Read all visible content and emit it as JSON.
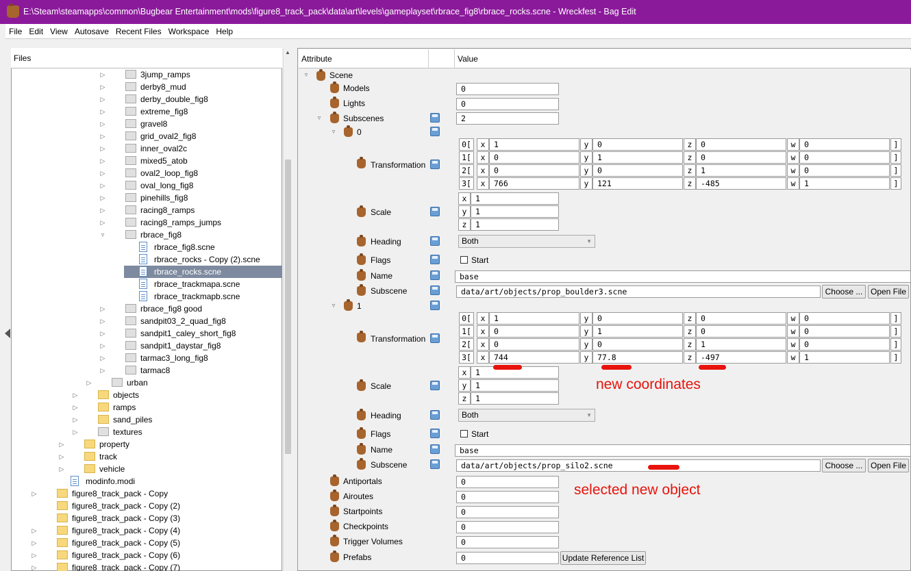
{
  "window": {
    "title": "E:\\Steam\\steamapps\\common\\Bugbear Entertainment\\mods\\figure8_track_pack\\data\\art\\levels\\gameplayset\\rbrace_fig8\\rbrace_rocks.scne - Wreckfest - Bag Edit",
    "title_color": "#8b1a9b"
  },
  "menu": [
    "File",
    "Edit",
    "View",
    "Autosave",
    "Recent Files",
    "Workspace",
    "Help"
  ],
  "files": {
    "header": "Files",
    "items": [
      {
        "label": "3jump_ramps",
        "type": "folder-gray",
        "indent": 3,
        "expander": "▷"
      },
      {
        "label": "derby8_mud",
        "type": "folder-gray",
        "indent": 3,
        "expander": "▷"
      },
      {
        "label": "derby_double_fig8",
        "type": "folder-gray",
        "indent": 3,
        "expander": "▷"
      },
      {
        "label": "extreme_fig8",
        "type": "folder-gray",
        "indent": 3,
        "expander": "▷"
      },
      {
        "label": "gravel8",
        "type": "folder-gray",
        "indent": 3,
        "expander": "▷"
      },
      {
        "label": "grid_oval2_fig8",
        "type": "folder-gray",
        "indent": 3,
        "expander": "▷"
      },
      {
        "label": "inner_oval2c",
        "type": "folder-gray",
        "indent": 3,
        "expander": "▷"
      },
      {
        "label": "mixed5_atob",
        "type": "folder-gray",
        "indent": 3,
        "expander": "▷"
      },
      {
        "label": "oval2_loop_fig8",
        "type": "folder-gray",
        "indent": 3,
        "expander": "▷"
      },
      {
        "label": "oval_long_fig8",
        "type": "folder-gray",
        "indent": 3,
        "expander": "▷"
      },
      {
        "label": "pinehills_fig8",
        "type": "folder-gray",
        "indent": 3,
        "expander": "▷"
      },
      {
        "label": "racing8_ramps",
        "type": "folder-gray",
        "indent": 3,
        "expander": "▷"
      },
      {
        "label": "racing8_ramps_jumps",
        "type": "folder-gray",
        "indent": 3,
        "expander": "▷"
      },
      {
        "label": "rbrace_fig8",
        "type": "folder-gray",
        "indent": 3,
        "expander": "▿"
      },
      {
        "label": "rbrace_fig8.scne",
        "type": "doc",
        "indent": 4,
        "expander": ""
      },
      {
        "label": "rbrace_rocks - Copy (2).scne",
        "type": "doc",
        "indent": 4,
        "expander": ""
      },
      {
        "label": "rbrace_rocks.scne",
        "type": "doc",
        "indent": 4,
        "expander": "",
        "selected": true
      },
      {
        "label": "rbrace_trackmapa.scne",
        "type": "doc",
        "indent": 4,
        "expander": ""
      },
      {
        "label": "rbrace_trackmapb.scne",
        "type": "doc",
        "indent": 4,
        "expander": ""
      },
      {
        "label": "rbrace_fig8 good",
        "type": "folder-gray",
        "indent": 3,
        "expander": "▷"
      },
      {
        "label": "sandpit03_2_quad_fig8",
        "type": "folder-gray",
        "indent": 3,
        "expander": "▷"
      },
      {
        "label": "sandpit1_caley_short_fig8",
        "type": "folder-gray",
        "indent": 3,
        "expander": "▷"
      },
      {
        "label": "sandpit1_daystar_fig8",
        "type": "folder-gray",
        "indent": 3,
        "expander": "▷"
      },
      {
        "label": "tarmac3_long_fig8",
        "type": "folder-gray",
        "indent": 3,
        "expander": "▷"
      },
      {
        "label": "tarmac8",
        "type": "folder-gray",
        "indent": 3,
        "expander": "▷"
      },
      {
        "label": "urban",
        "type": "folder-gray",
        "indent": 2,
        "expander": "▷"
      },
      {
        "label": "objects",
        "type": "folder-yellow",
        "indent": 1,
        "expander": "▷"
      },
      {
        "label": "ramps",
        "type": "folder-yellow",
        "indent": 1,
        "expander": "▷"
      },
      {
        "label": "sand_piles",
        "type": "folder-yellow",
        "indent": 1,
        "expander": "▷"
      },
      {
        "label": "textures",
        "type": "folder-gray",
        "indent": 1,
        "expander": "▷"
      },
      {
        "label": "property",
        "type": "folder-yellow",
        "indent": 0,
        "expander": "▷"
      },
      {
        "label": "track",
        "type": "folder-yellow",
        "indent": 0,
        "expander": "▷"
      },
      {
        "label": "vehicle",
        "type": "folder-yellow",
        "indent": 0,
        "expander": "▷"
      },
      {
        "label": "modinfo.modi",
        "type": "doc",
        "indent": -1,
        "expander": ""
      },
      {
        "label": "figure8_track_pack - Copy",
        "type": "folder-yellow",
        "indent": -2,
        "expander": "▷"
      },
      {
        "label": "figure8_track_pack - Copy (2)",
        "type": "folder-yellow",
        "indent": -2,
        "expander": ""
      },
      {
        "label": "figure8_track_pack - Copy (3)",
        "type": "folder-yellow",
        "indent": -2,
        "expander": ""
      },
      {
        "label": "figure8_track_pack - Copy (4)",
        "type": "folder-yellow",
        "indent": -2,
        "expander": "▷"
      },
      {
        "label": "figure8_track_pack - Copy (5)",
        "type": "folder-yellow",
        "indent": -2,
        "expander": "▷"
      },
      {
        "label": "figure8_track_pack - Copy (6)",
        "type": "folder-yellow",
        "indent": -2,
        "expander": "▷"
      },
      {
        "label": "figure8_track_pack - Copy (7)",
        "type": "folder-yellow",
        "indent": -2,
        "expander": "▷"
      }
    ]
  },
  "attributes": {
    "header_attr": "Attribute",
    "header_value": "Value",
    "scene": "Scene",
    "models": {
      "label": "Models",
      "value": "0"
    },
    "lights": {
      "label": "Lights",
      "value": "0"
    },
    "subscenes": {
      "label": "Subscenes",
      "value": "2"
    },
    "sub0": {
      "index": "0",
      "transformation_label": "Transformation",
      "matrix": [
        [
          "0[",
          "1",
          "0",
          "0",
          "0"
        ],
        [
          "1[",
          "0",
          "1",
          "0",
          "0"
        ],
        [
          "2[",
          "0",
          "0",
          "1",
          "0"
        ],
        [
          "3[",
          "766",
          "121",
          "-485",
          "1"
        ]
      ],
      "scale_label": "Scale",
      "scale": [
        "1",
        "1",
        "1"
      ],
      "heading_label": "Heading",
      "heading": "Both",
      "flags_label": "Flags",
      "flags_option": "Start",
      "name_label": "Name",
      "name": "base",
      "subscene_label": "Subscene",
      "subscene": "data/art/objects/prop_boulder3.scne"
    },
    "sub1": {
      "index": "1",
      "transformation_label": "Transformation",
      "matrix": [
        [
          "0[",
          "1",
          "0",
          "0",
          "0"
        ],
        [
          "1[",
          "0",
          "1",
          "0",
          "0"
        ],
        [
          "2[",
          "0",
          "0",
          "1",
          "0"
        ],
        [
          "3[",
          "744",
          "77.8",
          "-497",
          "1"
        ]
      ],
      "scale_label": "Scale",
      "scale": [
        "1",
        "1",
        "1"
      ],
      "heading_label": "Heading",
      "heading": "Both",
      "flags_label": "Flags",
      "flags_option": "Start",
      "name_label": "Name",
      "name": "base",
      "subscene_label": "Subscene",
      "subscene": "data/art/objects/prop_silo2.scne"
    },
    "axes": [
      "x",
      "y",
      "z",
      "w"
    ],
    "close_bracket": "]",
    "choose_label": "Choose ...",
    "open_file_label": "Open File",
    "antiportals": {
      "label": "Antiportals",
      "value": "0"
    },
    "airoutes": {
      "label": "Airoutes",
      "value": "0"
    },
    "startpoints": {
      "label": "Startpoints",
      "value": "0"
    },
    "checkpoints": {
      "label": "Checkpoints",
      "value": "0"
    },
    "trigger_volumes": {
      "label": "Trigger Volumes",
      "value": "0"
    },
    "prefabs": {
      "label": "Prefabs",
      "value": "0"
    },
    "update_reference": "Update Reference List"
  },
  "annotations": {
    "coordinates": "new coordinates",
    "object": "selected new object",
    "color": "#e8130c"
  }
}
